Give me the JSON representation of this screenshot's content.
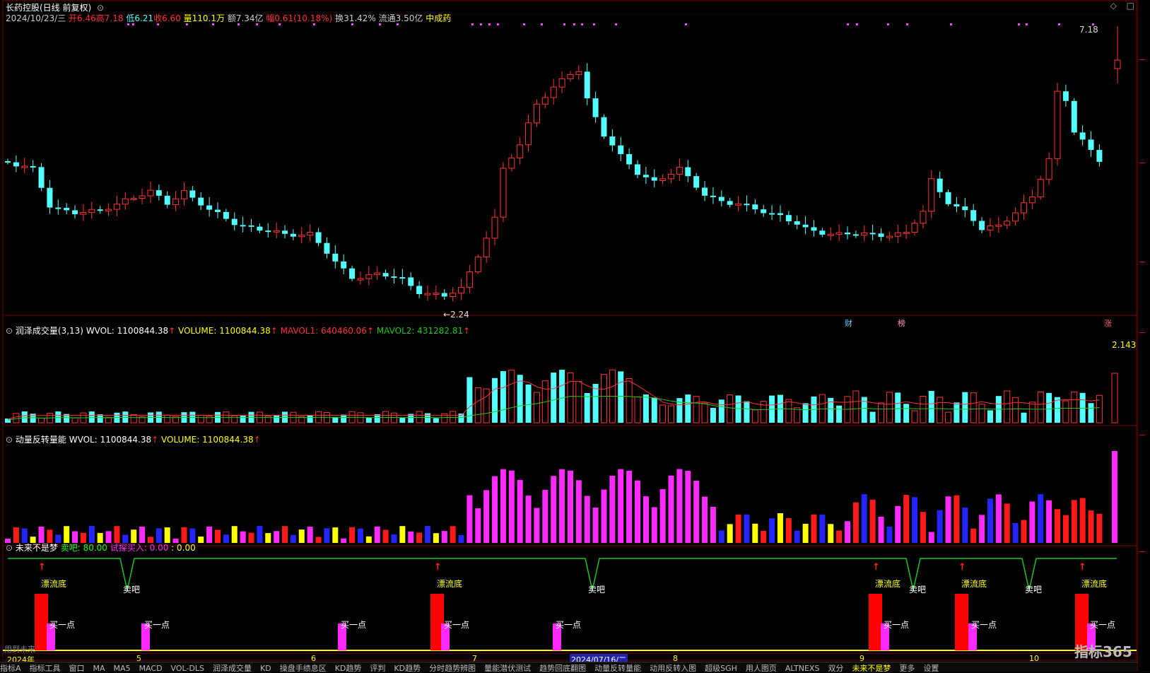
{
  "window": {
    "title": "长药控股(日线 前复权)",
    "controls": [
      "◇",
      "□"
    ]
  },
  "quote_line": {
    "date": "2024/10/23/三",
    "open": "开6.46",
    "high": "高7.18",
    "low": "低6.21",
    "close": "收6.60",
    "volume": "量110.1万",
    "amount": "额7.34亿",
    "change": "幅0.61(10.18%)",
    "turnover": "换31.42%",
    "float": "流通3.50亿",
    "sector": "中成药"
  },
  "price_labels": {
    "high_mark": "7.18",
    "low_mark": "2.24"
  },
  "event_markers": [
    "财",
    "榜",
    "涨"
  ],
  "panel2": {
    "name": "润泽成交量(3,13)",
    "wvol": "WVOL: 1100844.38",
    "volume": "VOLUME: 1100844.38",
    "mavol1": "MAVOL1: 640460.06",
    "mavol2": "MAVOL2: 431282.81",
    "right_value": "2.143"
  },
  "panel3": {
    "name": "动量反转量能",
    "wvol": "WVOL: 1100844.38",
    "volume": "VOLUME: 1100844.38"
  },
  "panel4": {
    "name": "未来不是梦",
    "sell": "卖吧: 80.00",
    "probe": "试探买入: 0.00",
    "extra": ": 0.00",
    "labels": {
      "bottom": "漂流底",
      "sell": "卖吧",
      "buy": "买一点"
    },
    "footer_left": "用到未来"
  },
  "time_axis": {
    "labels": [
      "2024年",
      "5",
      "6",
      "7",
      "2024/07/16/二",
      "8",
      "9",
      "10"
    ]
  },
  "bottom_tabs": [
    "指标A",
    "指标工具",
    "窗口",
    "MA",
    "MA5",
    "MACD",
    "VOL-DLS",
    "润泽成交量",
    "KD",
    "操盘手绩息区",
    "KD趋势",
    "评判",
    "KD趋势",
    "分时趋势辨图",
    "量能潜伏测试",
    "趋势回底翻图",
    "动量反转量能",
    "动用反转入图",
    "超级SGH",
    "用人图页",
    "ALTNEXS",
    "双分",
    "未来不是梦",
    "更多",
    "设置"
  ],
  "active_tab": "未来不是梦",
  "logo": "指标365",
  "colors": {
    "up": "#ff3333",
    "down": "#54ffff",
    "magenta": "#ff2aff",
    "red_bar": "#ff1a1a",
    "blue_bar": "#2424ff",
    "yellow_bar": "#ffff00",
    "green_line": "#18c818",
    "yellow_text": "#ffff00"
  }
}
